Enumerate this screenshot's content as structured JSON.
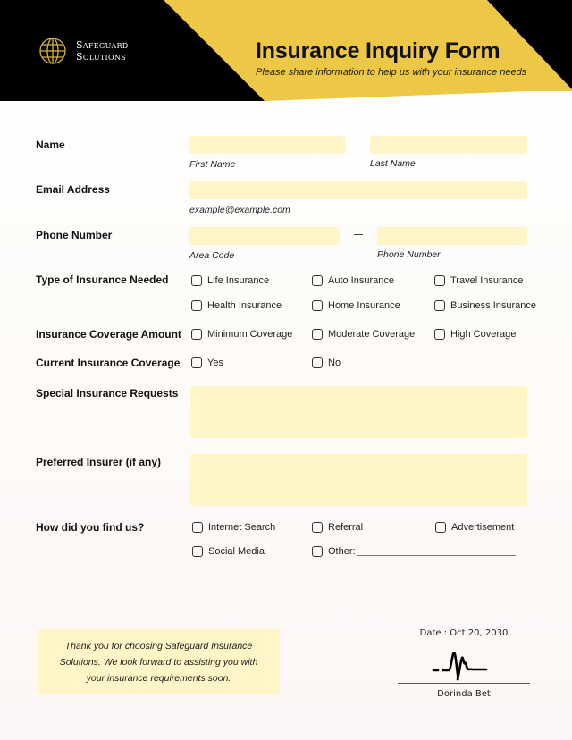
{
  "brand": {
    "line1": "Safeguard",
    "line2": "Solutions",
    "logo_icon": "globe-icon",
    "colors": {
      "yellow": "#ecc846",
      "black": "#000000",
      "field": "#fff5c7"
    }
  },
  "header": {
    "title": "Insurance Inquiry Form",
    "subtitle": "Please share information to help us with your insurance needs"
  },
  "form": {
    "name": {
      "label": "Name",
      "first_hint": "First Name",
      "last_hint": "Last Name",
      "first_value": "",
      "last_value": ""
    },
    "email": {
      "label": "Email Address",
      "hint": "example@example.com",
      "value": ""
    },
    "phone": {
      "label": "Phone Number",
      "area_hint": "Area Code",
      "number_hint": "Phone Number",
      "separator": "—",
      "area_value": "",
      "number_value": ""
    },
    "insurance_type": {
      "label": "Type of Insurance Needed",
      "options": [
        {
          "label": "Life Insurance",
          "checked": false
        },
        {
          "label": "Auto Insurance",
          "checked": false
        },
        {
          "label": "Travel Insurance",
          "checked": false
        },
        {
          "label": "Health Insurance",
          "checked": false
        },
        {
          "label": "Home Insurance",
          "checked": false
        },
        {
          "label": "Business Insurance",
          "checked": false
        }
      ]
    },
    "coverage_amount": {
      "label": "Insurance Coverage Amount",
      "options": [
        {
          "label": "Minimum Coverage",
          "checked": false
        },
        {
          "label": "Moderate Coverage",
          "checked": false
        },
        {
          "label": "High Coverage",
          "checked": false
        }
      ]
    },
    "current_coverage": {
      "label": "Current Insurance Coverage",
      "options": [
        {
          "label": "Yes",
          "checked": false
        },
        {
          "label": "No",
          "checked": false
        }
      ]
    },
    "special_requests": {
      "label": "Special Insurance Requests",
      "value": ""
    },
    "preferred_insurer": {
      "label": "Preferred Insurer (if any)",
      "value": ""
    },
    "referral_source": {
      "label": "How did you find us?",
      "options": [
        {
          "label": "Internet Search",
          "checked": false
        },
        {
          "label": "Referral",
          "checked": false
        },
        {
          "label": "Advertisement",
          "checked": false
        },
        {
          "label": "Social Media",
          "checked": false
        },
        {
          "label": "Other:",
          "checked": false
        }
      ],
      "other_value": ""
    }
  },
  "footer": {
    "thanks": "Thank you for choosing Safeguard Insurance Solutions. We look forward to assisting you with your insurance requirements soon.",
    "date": "Date : Oct 20, 2030",
    "signer": "Dorinda Bet"
  }
}
